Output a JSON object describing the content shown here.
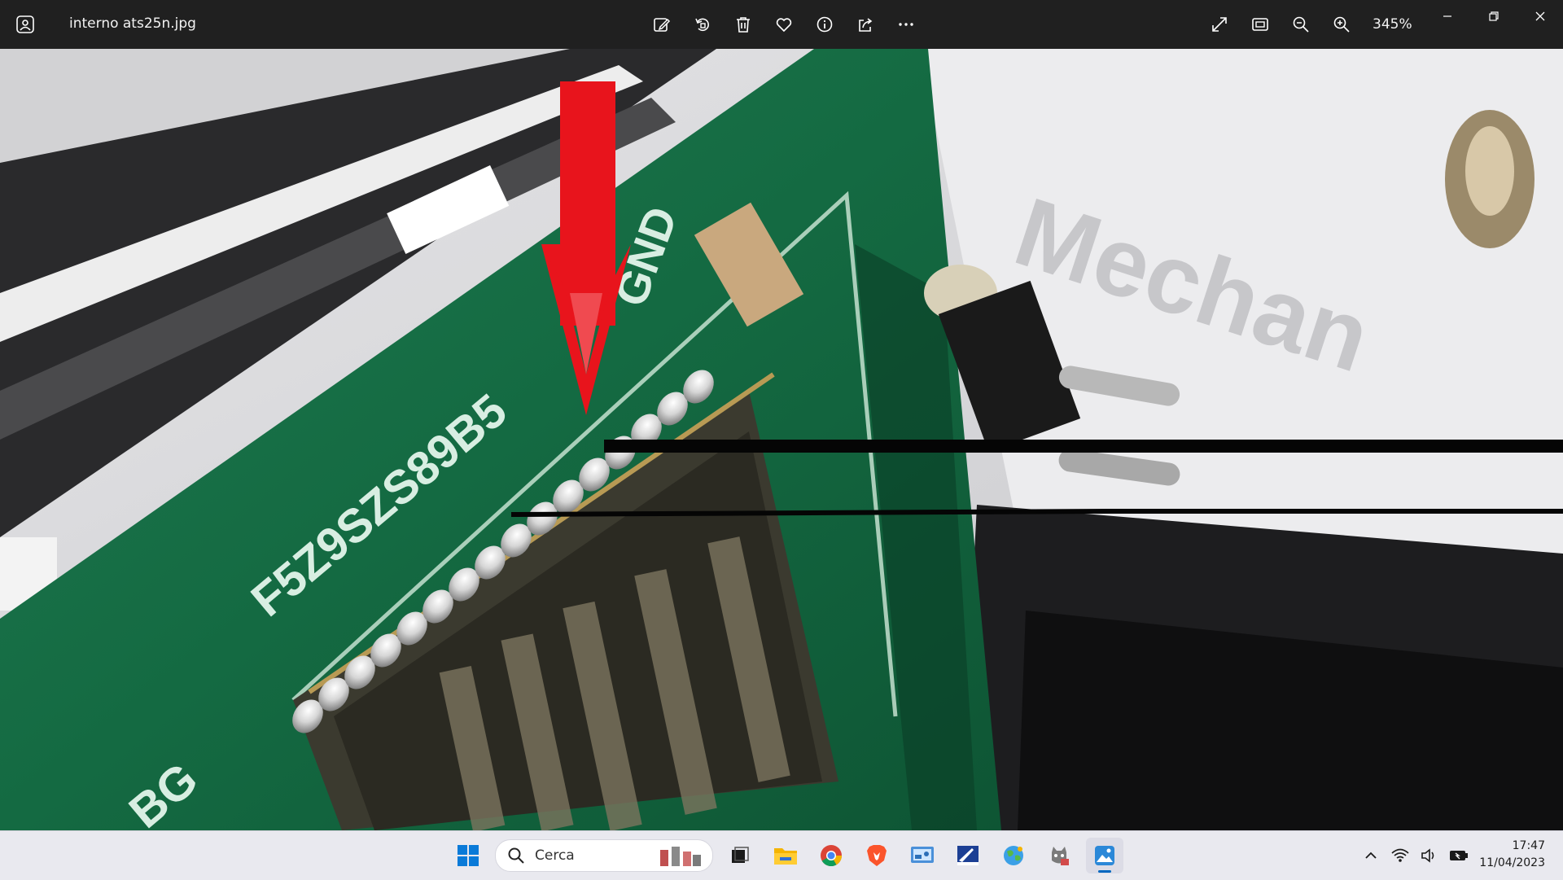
{
  "window": {
    "file_name": "interno ats25n.jpg",
    "zoom_level": "345%"
  },
  "toolbar": {
    "items": [
      "edit-icon",
      "rotate-icon",
      "delete-icon",
      "favorite-icon",
      "info-icon",
      "share-icon",
      "more-icon"
    ]
  },
  "view_tools": {
    "items": [
      "fullscreen-icon",
      "fit-to-window-icon",
      "zoom-out-icon",
      "zoom-in-icon"
    ]
  },
  "taskbar": {
    "search_placeholder": "Cerca",
    "apps": [
      "start-icon",
      "task-view-icon",
      "file-explorer-icon",
      "chrome-icon",
      "brave-icon",
      "control-panel-icon",
      "setup-icon",
      "globe-app-icon",
      "cat-app-icon",
      "photos-app-icon"
    ],
    "clock_time": "17:47",
    "clock_date": "11/04/2023"
  },
  "photo": {
    "silkscreen_text": "F5Z9SZS89B5",
    "label_text": "BG",
    "background_text": "Mechan",
    "annotation_color": "#e8141c"
  }
}
